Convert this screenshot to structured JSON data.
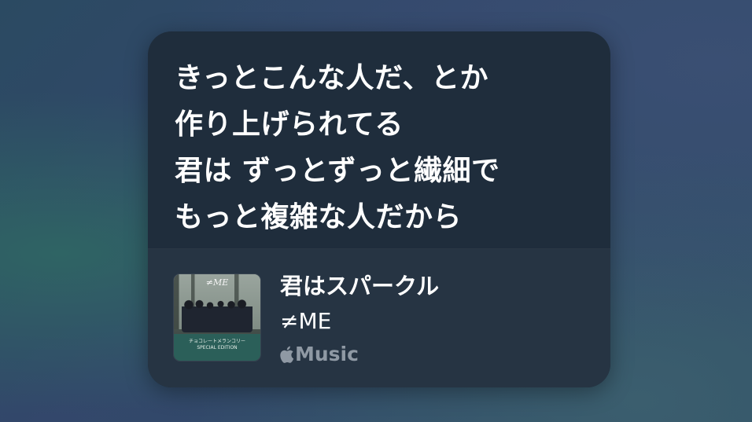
{
  "lyrics": {
    "lines": [
      "きっとこんな人だ、とか",
      "作り上げられてる",
      "君は ずっとずっと繊細で",
      "もっと複雑な人だから"
    ]
  },
  "track": {
    "title": "君はスパークル",
    "artist": "≠ME",
    "service_icon": "apple-logo-icon",
    "service_label": "Music",
    "artwork": {
      "logo": "≠ME",
      "footer_text": "チョコレートメランコリー",
      "footer_subtext": "SPECIAL EDITION"
    }
  },
  "colors": {
    "card": "#1f2d3c",
    "track_area": "#263443",
    "text_primary": "#ffffff",
    "text_secondary": "#8f99a4"
  }
}
